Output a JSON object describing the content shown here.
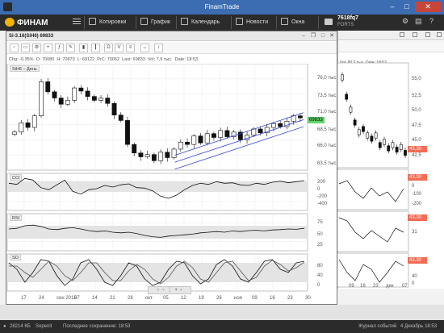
{
  "app": {
    "title": "FinamTrade"
  },
  "toolbar": {
    "logo": "ФИНАМ",
    "items": [
      {
        "label": "Котировки"
      },
      {
        "label": "График"
      },
      {
        "label": "Календарь"
      },
      {
        "label": "Новости"
      },
      {
        "label": "Окна"
      }
    ],
    "account_id": "7618fq7",
    "account_sub": "FORTS"
  },
  "chart": {
    "title": "Si-3.16(SiH6) 69833",
    "info_chg": "Chg: -0,35%",
    "info_o": "O: 70080",
    "info_h": "H: 70870",
    "info_l": "L: 69122",
    "info_prc": "PrC: 70062",
    "info_last": "Last: 69833",
    "info_vol": "Vol: 7,9 тыс.",
    "info_date": "Date: 18:53",
    "series_label": "SiH6 – День",
    "last_price": "69833",
    "price_ticks": [
      "76,0 тыс.",
      "73,5 тыс.",
      "71,0 тыс.",
      "68,5 тыс.",
      "66,0 тыс.",
      "63,5 тыс."
    ],
    "cci_label": "CCI",
    "cci_ticks": [
      "200",
      "0",
      "-200",
      "-400"
    ],
    "rsi_label": "RSI",
    "rsi_ticks": [
      "75",
      "50",
      "25"
    ],
    "so_label": "SO",
    "so_ticks": [
      "80",
      "40",
      "0"
    ],
    "x_ticks": [
      "17",
      "24",
      "сен 2015",
      "07",
      "14",
      "21",
      "28",
      "окт",
      "05",
      "12",
      "19",
      "26",
      "ноя",
      "09",
      "16",
      "23",
      "30"
    ]
  },
  "back_chart": {
    "info": "Vol: 80,2 тыс.  Date: 18:53",
    "price_ticks": [
      "55,0",
      "52,5",
      "50,0",
      "47,5",
      "45,0",
      "42,5"
    ],
    "cci_ticks": [
      "0",
      "-100",
      "-200"
    ],
    "rsi_ticks": [
      "31"
    ],
    "so_ticks": [
      "40",
      "0"
    ],
    "x_ticks": [
      "09",
      "16",
      "23",
      "дек",
      "07"
    ],
    "last_price": "43,30"
  },
  "statusbar": {
    "memory": "28214 КБ",
    "server": "Sopenit",
    "saved": "Последнее сохранение: 18:53",
    "journal": "Журнал событий",
    "date": "4 Декабрь 18:53"
  },
  "chart_data": [
    {
      "type": "candlestick",
      "title": "Si-3.16(SiH6) 69833",
      "x": [
        "17",
        "24",
        "сен 2015",
        "07",
        "14",
        "21",
        "28",
        "окт",
        "05",
        "12",
        "19",
        "26",
        "ноя",
        "09",
        "16",
        "23",
        "30"
      ],
      "ylim": [
        63500,
        76000
      ],
      "last": 69833,
      "series": [
        {
          "name": "SiH6 – День",
          "values": [
            68000,
            69200,
            68600,
            70100,
            74500,
            73200,
            72400,
            71600,
            72100,
            73700,
            73300,
            72600,
            72100,
            72400,
            71700,
            70200,
            69500,
            66400,
            65300,
            64800,
            65100,
            64300,
            65400,
            64700,
            65800,
            66700,
            66400,
            67500,
            66600,
            67800,
            67300,
            68200,
            67400,
            68000,
            67000,
            67600,
            68400,
            67900,
            68600,
            69100,
            68700,
            69400,
            70100,
            69833
          ]
        }
      ]
    },
    {
      "type": "line",
      "title": "CCI",
      "ylim": [
        -400,
        200
      ],
      "series": [
        {
          "name": "CCI",
          "values": [
            60,
            40,
            150,
            120,
            -20,
            -60,
            30,
            120,
            -90,
            -140,
            -60,
            -40,
            20,
            -10,
            30,
            50,
            -20,
            -30,
            -80,
            -180,
            -220,
            -160,
            -60,
            20,
            60,
            40,
            90,
            60,
            70,
            30,
            20,
            60,
            40,
            80,
            100,
            70,
            90,
            110
          ]
        }
      ]
    },
    {
      "type": "line",
      "title": "RSI",
      "ylim": [
        0,
        100
      ],
      "series": [
        {
          "name": "RSI",
          "values": [
            60,
            62,
            70,
            72,
            68,
            60,
            58,
            62,
            64,
            60,
            55,
            52,
            54,
            50,
            48,
            50,
            46,
            40,
            36,
            34,
            38,
            40,
            42,
            44,
            48,
            50,
            52,
            50,
            54,
            52,
            55,
            56,
            54,
            57,
            58,
            60,
            59,
            62
          ]
        }
      ]
    },
    {
      "type": "line",
      "title": "SO",
      "ylim": [
        0,
        100
      ],
      "series": [
        {
          "name": "%K",
          "values": [
            80,
            60,
            20,
            50,
            90,
            85,
            40,
            10,
            30,
            80,
            90,
            60,
            20,
            10,
            40,
            80,
            70,
            30,
            10,
            20,
            60,
            85,
            80,
            40,
            15,
            30,
            75,
            90,
            70,
            30,
            20,
            50,
            85,
            90,
            60,
            50,
            80,
            85
          ]
        },
        {
          "name": "%D",
          "values": [
            70,
            70,
            50,
            35,
            60,
            85,
            70,
            40,
            25,
            50,
            80,
            80,
            50,
            25,
            25,
            55,
            75,
            60,
            30,
            15,
            35,
            70,
            85,
            65,
            30,
            20,
            50,
            80,
            85,
            55,
            25,
            35,
            70,
            88,
            75,
            55,
            65,
            82
          ]
        }
      ]
    }
  ]
}
